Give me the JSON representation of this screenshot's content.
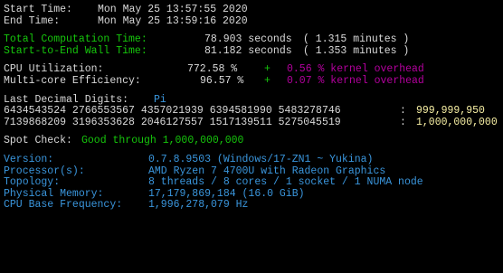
{
  "window": {
    "background": "#000000",
    "colors": {
      "default_text": "#d9d9d9",
      "green": "#16c60c",
      "magenta": "#b4009e",
      "yellow": "#f9f1a5",
      "blue": "#3a96dd"
    }
  },
  "times": {
    "start_label": "Start Time:",
    "start_value": "Mon May 25 13:57:55 2020",
    "end_label": "End Time:",
    "end_value": "Mon May 25 13:59:16 2020"
  },
  "durations": {
    "compute_label": "Total Computation Time:",
    "compute_seconds": "78.903 seconds",
    "compute_minutes": "( 1.315 minutes )",
    "wall_label": "Start-to-End Wall Time:",
    "wall_seconds": "81.182 seconds",
    "wall_minutes": "( 1.353 minutes )"
  },
  "cpu": {
    "util_label": "CPU Utilization:",
    "util_value": "772.58 %",
    "util_sep": "+",
    "util_overhead": "0.56 % kernel overhead",
    "eff_label": "Multi-core Efficiency:",
    "eff_value": "96.57 %",
    "eff_sep": "+",
    "eff_overhead": "0.07 % kernel overhead"
  },
  "digits": {
    "label": "Last Decimal Digits:",
    "constant": "Pi",
    "rows": [
      {
        "digits": "6434543524 2766553567 4357021939 6394581990 5483278746",
        "sep": ":",
        "position": "999,999,950"
      },
      {
        "digits": "7139868209 3196353628 2046127557 1517139511 5275045519",
        "sep": ":",
        "position": "1,000,000,000"
      }
    ]
  },
  "spot_check": {
    "label": "Spot Check:",
    "result": "Good through 1,000,000,000"
  },
  "system": {
    "version_label": "Version:",
    "version_value": "0.7.8.9503 (Windows/17-ZN1 ~ Yukina)",
    "processor_label": "Processor(s):",
    "processor_value": "AMD Ryzen 7 4700U with Radeon Graphics",
    "topology_label": "Topology:",
    "topology_value": "8 threads / 8 cores / 1 socket / 1 NUMA node",
    "memory_label": "Physical Memory:",
    "memory_value": "17,179,869,184 (16.0 GiB)",
    "freq_label": "CPU Base Frequency:",
    "freq_value": "1,996,278,079 Hz"
  }
}
